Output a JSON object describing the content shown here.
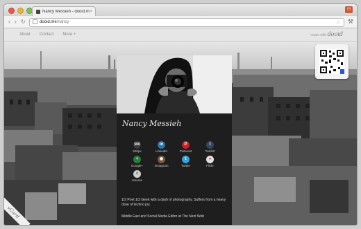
{
  "browser": {
    "tab_title": "Nancy Messieh - dooid.me",
    "tab_close": "×",
    "back": "‹",
    "forward": "›",
    "reload": "↻",
    "url_host": "dooid.me",
    "url_path": "/nancy",
    "star": "☆",
    "menu": "⚒"
  },
  "site": {
    "nav": [
      "About",
      "Contact",
      "More +"
    ],
    "made_with_prefix": "made with",
    "made_with_logo": "dooid"
  },
  "profile": {
    "name": "Nancy Messieh",
    "social": [
      {
        "label": "500px",
        "glyph": "500",
        "color": "#3a3a3a"
      },
      {
        "label": "LinkedIn",
        "glyph": "in",
        "color": "#2c73a8"
      },
      {
        "label": "Pinterest",
        "glyph": "P",
        "color": "#c8232c"
      },
      {
        "label": "Tumblr",
        "glyph": "t",
        "color": "#35465c"
      },
      {
        "label": "Google+",
        "glyph": "+",
        "color": "#2d7a3a"
      },
      {
        "label": "Instagram",
        "glyph": "◉",
        "color": "#7a5a44"
      },
      {
        "label": "Twitter",
        "glyph": "t",
        "color": "#3aa3d6"
      },
      {
        "label": "Flickr",
        "glyph": "●",
        "color": "#e0e0e0"
      },
      {
        "label": "resume",
        "glyph": "≡",
        "color": "#cfcfcf"
      }
    ],
    "bio": "1/2 Poet 1/2 Geek with a dash of photography. Suffers from a heavy dose of techno joy.",
    "bio_role": "Middle East and Social Media Editor at The Next Web"
  },
  "vcard_label": "vCard",
  "colors": {
    "accent": "#c85c3a"
  }
}
